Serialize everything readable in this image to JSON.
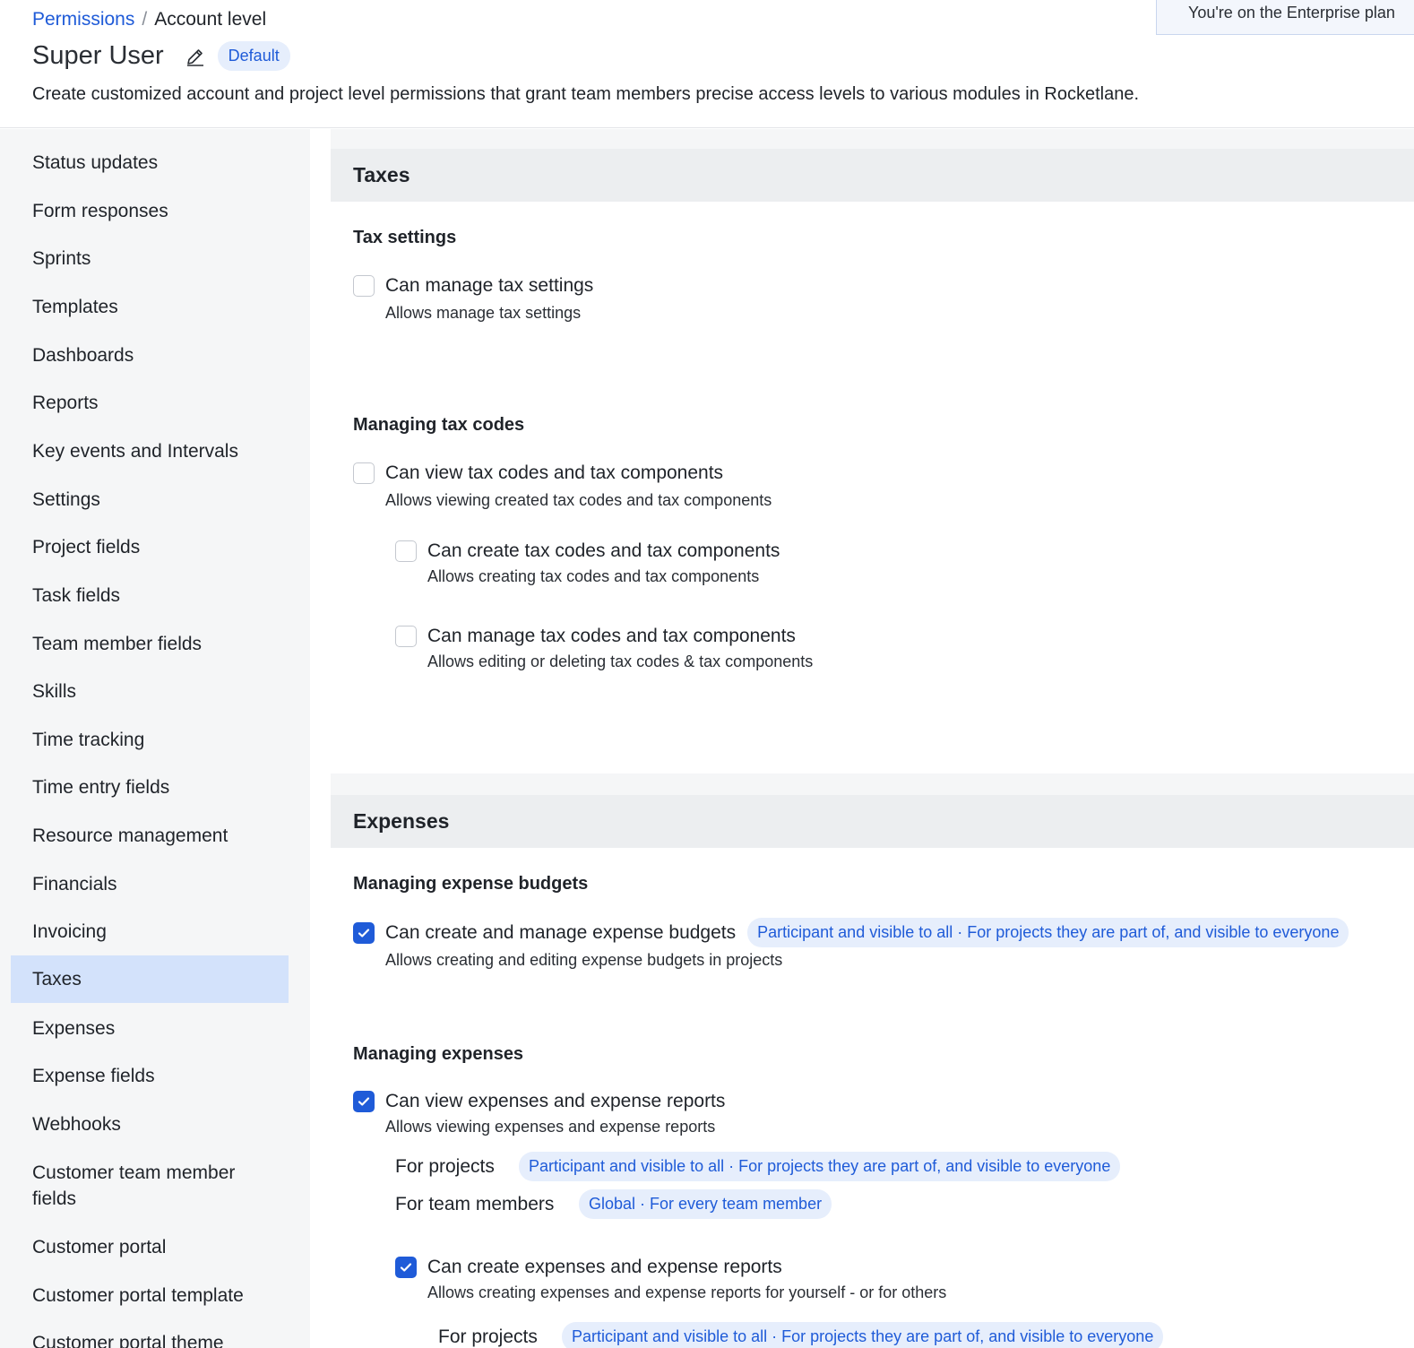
{
  "header": {
    "breadcrumb": {
      "link": "Permissions",
      "separator": "/",
      "current": "Account level"
    },
    "title": "Super User",
    "badge": "Default",
    "subtitle": "Create customized account and project level permissions that grant team members precise access levels to various modules in Rocketlane.",
    "plan_notice": "You're on the Enterprise plan"
  },
  "sidebar": {
    "items": [
      "Status updates",
      "Form responses",
      "Sprints",
      "Templates",
      "Dashboards",
      "Reports",
      "Key events and Intervals",
      "Settings",
      "Project fields",
      "Task fields",
      "Team member fields",
      "Skills",
      "Time tracking",
      "Time entry fields",
      "Resource management",
      "Financials",
      "Invoicing",
      "Taxes",
      "Expenses",
      "Expense fields",
      "Webhooks",
      "Customer team member\nfields",
      "Customer portal",
      "Customer portal template",
      "Customer portal theme"
    ],
    "active": "Taxes"
  },
  "taxes": {
    "heading": "Taxes",
    "tax_settings": {
      "title": "Tax settings",
      "manage": {
        "label": "Can manage tax settings",
        "desc": "Allows manage tax settings",
        "checked": false
      }
    },
    "tax_codes": {
      "title": "Managing tax codes",
      "view": {
        "label": "Can view tax codes and tax components",
        "desc": "Allows viewing created tax codes and tax components",
        "checked": false
      },
      "create": {
        "label": "Can create tax codes and tax components",
        "desc": "Allows creating tax codes and tax components",
        "checked": false
      },
      "manage": {
        "label": "Can manage tax codes and tax components",
        "desc": "Allows editing or deleting tax codes & tax components",
        "checked": false
      }
    }
  },
  "expenses": {
    "heading": "Expenses",
    "budgets": {
      "title": "Managing expense budgets",
      "create_manage": {
        "label": "Can create and manage expense budgets",
        "scope": "Participant and visible to all · For projects they are part of, and visible to everyone",
        "desc": "Allows creating and editing expense budgets in projects",
        "checked": true
      }
    },
    "managing": {
      "title": "Managing expenses",
      "view": {
        "label": "Can view expenses and expense reports",
        "desc": "Allows viewing expenses and expense reports",
        "checked": true,
        "for_projects_label": "For projects",
        "for_projects_scope": "Participant and visible to all · For projects they are part of, and visible to everyone",
        "for_members_label": "For team members",
        "for_members_scope": "Global · For every team member"
      },
      "create": {
        "label": "Can create expenses and expense reports",
        "desc": "Allows creating expenses and expense reports for yourself - or for others",
        "checked": true,
        "for_projects_label": "For projects",
        "for_projects_scope": "Participant and visible to all · For projects they are part of, and visible to everyone"
      }
    }
  },
  "colors": {
    "accent": "#1f5bd8",
    "pill_bg": "#e6eefc",
    "active_nav": "#d3e2fb",
    "sidebar_bg": "#f5f6f7",
    "section_head_bg": "#eceef0"
  }
}
